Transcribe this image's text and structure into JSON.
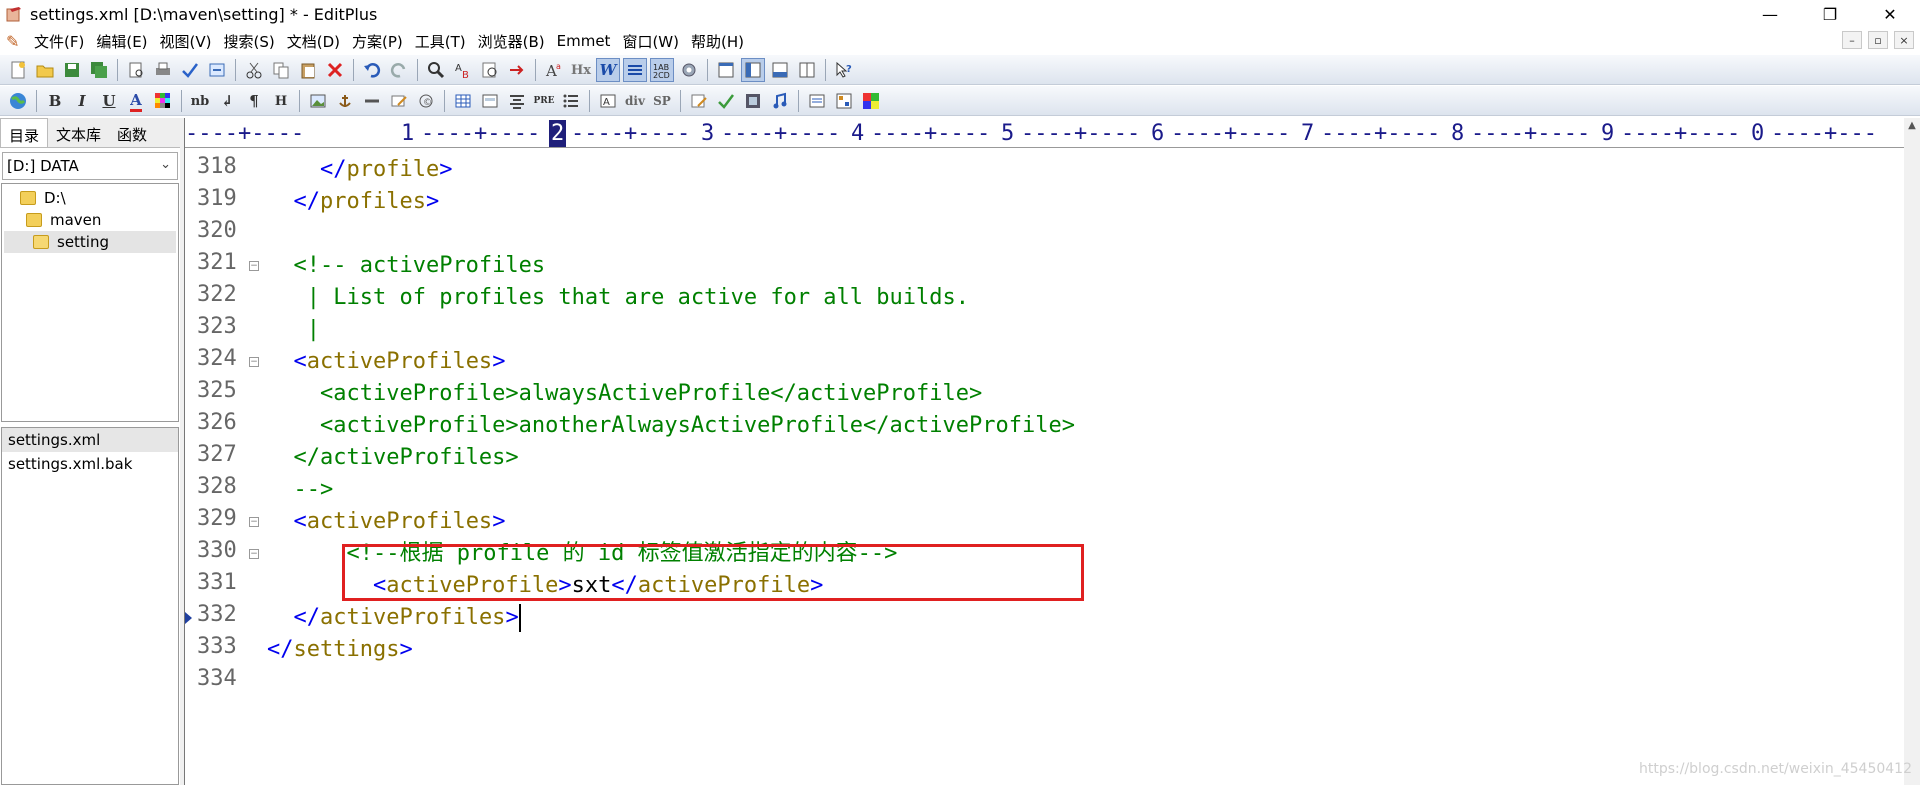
{
  "window": {
    "title": "settings.xml [D:\\maven\\setting] * - EditPlus",
    "controls": [
      "—",
      "❐",
      "✕"
    ]
  },
  "menu": {
    "items": [
      "文件(F)",
      "编辑(E)",
      "视图(V)",
      "搜索(S)",
      "文档(D)",
      "方案(P)",
      "工具(T)",
      "浏览器(B)",
      "Emmet",
      "窗口(W)",
      "帮助(H)"
    ],
    "mdi_controls": [
      "–",
      "▫",
      "×"
    ]
  },
  "toolbar2": {
    "bold": "B",
    "italic": "I",
    "underline": "U",
    "font": "A",
    "nbsp": "nb",
    "br": "↲",
    "para": "¶",
    "heading": "H",
    "pre": "PRE",
    "div": "div",
    "span": "SP"
  },
  "left_panel": {
    "tabs": [
      "目录",
      "文本库",
      "函数"
    ],
    "drive": "[D:] DATA",
    "tree": [
      "D:\\",
      "maven",
      "setting"
    ],
    "files": [
      "settings.xml",
      "settings.xml.bak"
    ]
  },
  "ruler": {
    "numbers": [
      "1",
      "2",
      "3",
      "4",
      "5",
      "6",
      "7",
      "8",
      "9",
      "0"
    ],
    "current_column_marker": "2"
  },
  "editor": {
    "line_numbers": [
      "318",
      "319",
      "320",
      "321",
      "322",
      "323",
      "324",
      "325",
      "326",
      "327",
      "328",
      "329",
      "330",
      "331",
      "332",
      "333",
      "334"
    ],
    "lines": [
      {
        "indent": "    ",
        "open": "</",
        "name": "profile",
        "close": ">"
      },
      {
        "indent": "  ",
        "open": "</",
        "name": "profiles",
        "close": ">"
      },
      {
        "blank": true
      },
      {
        "indent": "  ",
        "comment": "<!-- activeProfiles"
      },
      {
        "indent": "   ",
        "comment": "| List of profiles that are active for all builds."
      },
      {
        "indent": "   ",
        "comment": "|"
      },
      {
        "indent": "  ",
        "open": "<",
        "name": "activeProfiles",
        "close": ">"
      },
      {
        "indent": "    ",
        "comment": "<activeProfile>alwaysActiveProfile</activeProfile>"
      },
      {
        "indent": "    ",
        "comment": "<activeProfile>anotherAlwaysActiveProfile</activeProfile>"
      },
      {
        "indent": "  ",
        "comment": "</activeProfiles>"
      },
      {
        "indent": "  ",
        "comment": "-->"
      },
      {
        "indent": "  ",
        "open": "<",
        "name": "activeProfiles",
        "close": ">"
      },
      {
        "indent": "      ",
        "comment": "<!--根据 profile 的 id 标签值激活指定的内容-->"
      },
      {
        "indent": "        ",
        "open": "<",
        "name": "activeProfile",
        "close": ">",
        "text": "sxt",
        "open2": "</",
        "name2": "activeProfile",
        "close2": ">"
      },
      {
        "indent": "  ",
        "open": "</",
        "name": "activeProfiles",
        "close": ">",
        "caret": true
      },
      {
        "indent": "",
        "open": "</",
        "name": "settings",
        "close": ">"
      },
      {
        "blank": true
      }
    ]
  },
  "watermark": "https://blog.csdn.net/weixin_45450412"
}
